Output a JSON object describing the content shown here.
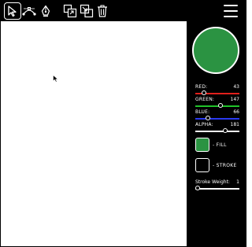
{
  "toolbar": {
    "tools": [
      {
        "name": "select-tool",
        "icon": "cursor-arrow-icon",
        "selected": true
      },
      {
        "name": "node-tool",
        "icon": "bezier-nodes-icon",
        "selected": false
      },
      {
        "name": "pen-tool",
        "icon": "pen-nib-icon",
        "selected": false
      },
      {
        "name": "bring-forward-tool",
        "icon": "bring-forward-icon",
        "selected": false
      },
      {
        "name": "send-backward-tool",
        "icon": "send-backward-icon",
        "selected": false
      },
      {
        "name": "delete-tool",
        "icon": "trash-icon",
        "selected": false
      }
    ],
    "menu_icon": "hamburger-menu-icon"
  },
  "color": {
    "preview_color": "#2b9342",
    "red": {
      "label": "RED:",
      "value": "43",
      "max": 255,
      "color": "#e0201c"
    },
    "green": {
      "label": "GREEN:",
      "value": "147",
      "max": 255,
      "color": "#21c32a"
    },
    "blue": {
      "label": "BLUE:",
      "value": "66",
      "max": 255,
      "color": "#2a39ef"
    },
    "alpha": {
      "label": "ALPHA:",
      "value": "181",
      "max": 255,
      "color": "#ffffff"
    }
  },
  "fill": {
    "label": "- FILL"
  },
  "stroke": {
    "label": "- STROKE"
  },
  "stroke_weight": {
    "label": "Stroke Weight:",
    "value": "1"
  }
}
